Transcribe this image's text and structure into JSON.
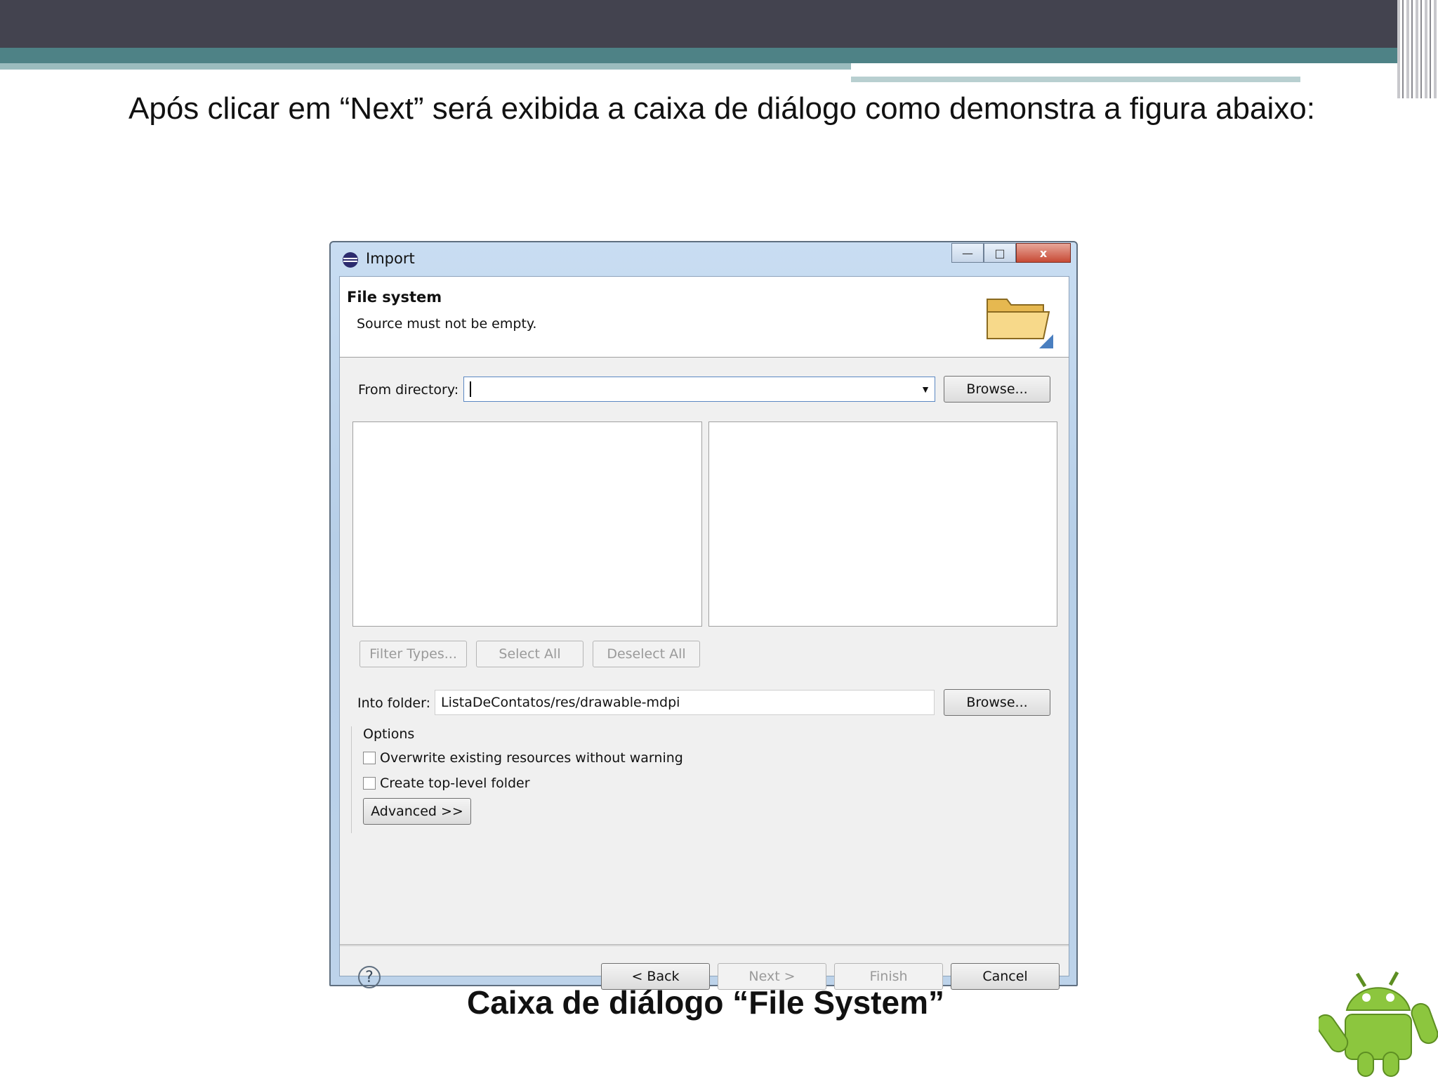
{
  "slide": {
    "text": "Após clicar em “Next” será exibida a caixa de diálogo como demonstra a figura abaixo:",
    "caption": "Caixa de diálogo “File System”"
  },
  "dialog": {
    "title": "Import",
    "window_buttons": {
      "minimize": "—",
      "maximize": "□",
      "close": "x"
    },
    "banner": {
      "title": "File system",
      "message": "Source must not be empty."
    },
    "from_directory": {
      "label": "From directory:",
      "value": "",
      "browse_label": "Browse..."
    },
    "selection_buttons": {
      "filter_types": "Filter Types...",
      "select_all": "Select All",
      "deselect_all": "Deselect All"
    },
    "into_folder": {
      "label": "Into folder:",
      "value": "ListaDeContatos/res/drawable-mdpi",
      "browse_label": "Browse..."
    },
    "options": {
      "heading": "Options",
      "overwrite": {
        "label": "Overwrite existing resources without warning",
        "checked": false
      },
      "create_top_level": {
        "label": "Create top-level folder",
        "checked": false
      },
      "advanced_label": "Advanced >>"
    },
    "footer": {
      "help_icon": "question-mark",
      "back_label": "< Back",
      "next_label": "Next >",
      "finish_label": "Finish",
      "cancel_label": "Cancel"
    }
  },
  "colors": {
    "header_dark": "#43434f",
    "header_teal": "#4e8286",
    "dialog_frame": "#b7cfe8",
    "dialog_body": "#f0f0f0",
    "disabled_text": "#9a9a9a"
  }
}
